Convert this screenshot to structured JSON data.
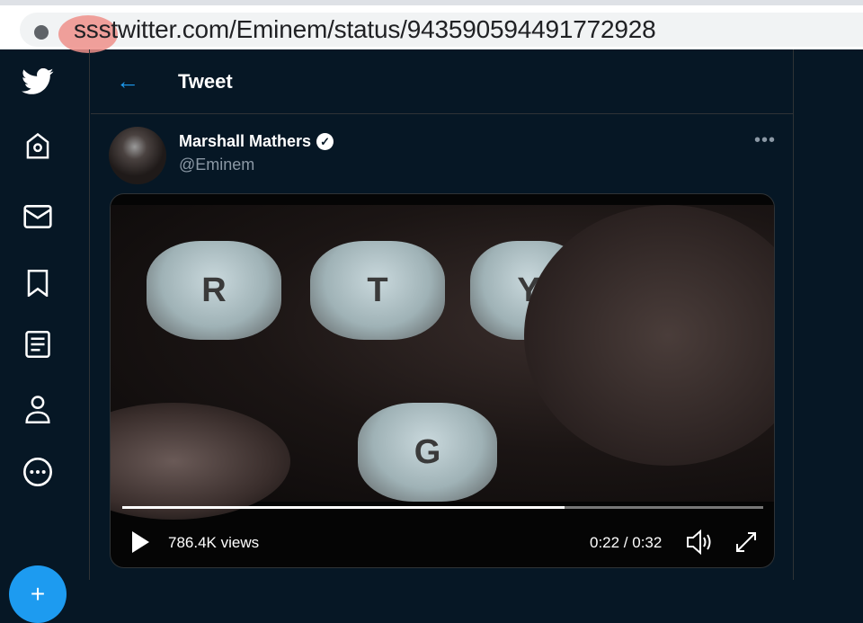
{
  "browser": {
    "url": "ssstwitter.com/Eminem/status/943590594491772928"
  },
  "sidebar": {
    "items": [
      {
        "name": "twitter-logo"
      },
      {
        "name": "home"
      },
      {
        "name": "messages"
      },
      {
        "name": "bookmarks"
      },
      {
        "name": "lists"
      },
      {
        "name": "profile"
      },
      {
        "name": "more"
      }
    ],
    "compose_label": "+"
  },
  "header": {
    "title": "Tweet"
  },
  "tweet": {
    "name": "Marshall Mathers",
    "handle": "@Eminem",
    "verified": true
  },
  "video": {
    "keys": [
      "R",
      "T",
      "Y",
      "G"
    ],
    "views": "786.4K views",
    "time": "0:22 / 0:32",
    "progress": 0.69
  },
  "colors": {
    "accent": "#1d9bf0",
    "background": "#061725"
  }
}
